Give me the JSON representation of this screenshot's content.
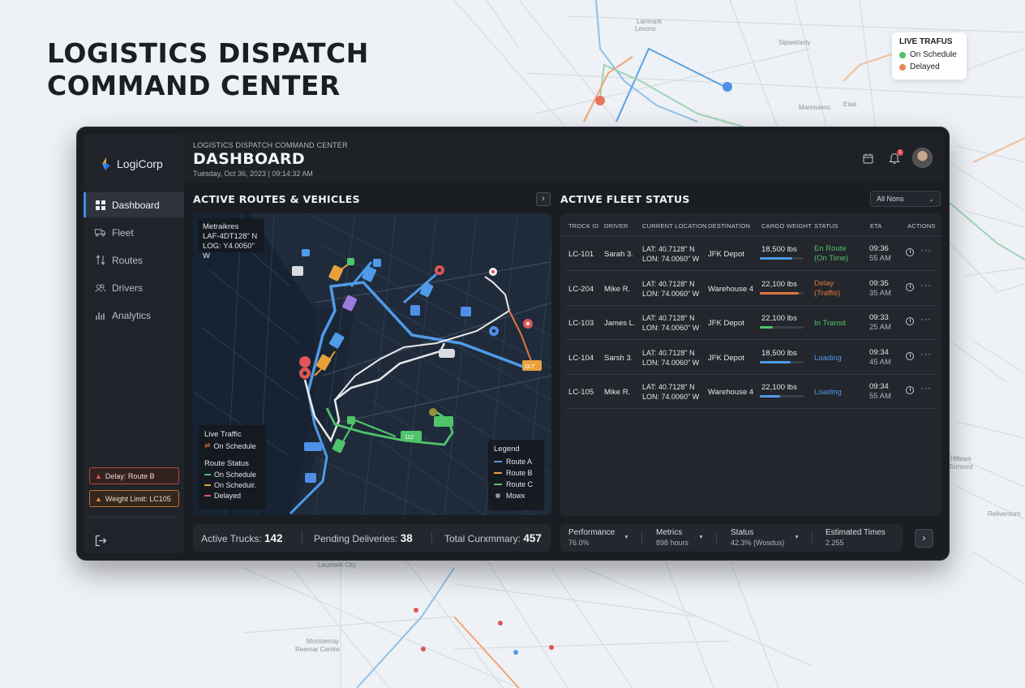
{
  "hero": {
    "line1": "LOGISTICS DISPATCH",
    "line2": "COMMAND CENTER"
  },
  "live_card": {
    "title": "LIVE TRAFUS",
    "items": [
      {
        "label": "On Schedule",
        "color": "#4fc46a"
      },
      {
        "label": "Delayed",
        "color": "#e58a5a"
      }
    ]
  },
  "background_labels": {
    "l1": "Lanmark",
    "l2": "Lexons",
    "l3": "Sipwetterty",
    "l4": "Maretoienc",
    "l5": "Etae",
    "l6": "Leumark City",
    "l7": "Montserray",
    "l8": "Reemar Centre",
    "l9": "Hitlows",
    "l10": "Tormord",
    "l11": "Reliveroum"
  },
  "logo": {
    "name": "LogiCorp"
  },
  "header": {
    "supertitle": "LOGISTICS DISPATCH COMMAND CENTER",
    "title": "DASHBOARD",
    "datetime": "Tuesday, Oct 36, 2023 | 09:14:32 AM",
    "notification_count": "1"
  },
  "nav": [
    {
      "label": "Dashboard",
      "icon": "grid-icon",
      "active": true
    },
    {
      "label": "Fleet",
      "icon": "truck-icon",
      "active": false
    },
    {
      "label": "Routes",
      "icon": "route-icon",
      "active": false
    },
    {
      "label": "Drivers",
      "icon": "users-icon",
      "active": false
    },
    {
      "label": "Analytics",
      "icon": "bar-chart-icon",
      "active": false
    }
  ],
  "alerts": [
    {
      "label": "Delay: Route B"
    },
    {
      "label": "Weight Limit: LC105"
    }
  ],
  "routes_section": {
    "title": "ACTIVE ROUTES & VEHICLES",
    "coords": {
      "line1": "Metraikres",
      "line2": "LAF-4DT128\" N",
      "line3": "LOG: Y4.0050\" W"
    },
    "traffic": {
      "title": "Live Traffic",
      "live_item": "On Schedule",
      "status_title": "Route Status",
      "items": [
        {
          "label": "On Schedule",
          "color": "#4fc46a"
        },
        {
          "label": "On Scheduir.",
          "color": "#e8a13a"
        },
        {
          "label": "Delayed",
          "color": "#e05555"
        }
      ]
    },
    "legend": {
      "title": "Legend",
      "items": [
        {
          "label": "Route A",
          "color": "#4f9be8"
        },
        {
          "label": "Route B",
          "color": "#e8a13a"
        },
        {
          "label": "Route C",
          "color": "#4fc46a"
        },
        {
          "label": "Mowx",
          "color": "#8e949d"
        }
      ]
    },
    "truck_labels": {
      "t1": "112",
      "t2": "DLT"
    }
  },
  "fleet": {
    "title": "ACTIVE FLEET STATUS",
    "filter": "All Nons",
    "columns": [
      "TROCK ID",
      "DRIVER",
      "CURRENT LOCATION",
      "DESTINATION",
      "CARGO WEIGHT",
      "STATUS",
      "ETA",
      "ACTIONS"
    ],
    "rows": [
      {
        "id": "LC-101",
        "driver": "Sarah 3.",
        "lat": "LAT: 40.7128\" N",
        "lon": "LON: 74.0060\" W",
        "dest": "JFK Depot",
        "cargo": "18,500 lbs",
        "cargo_pct": 0.74,
        "cargo_color": "#4f9be8",
        "status1": "En Route",
        "status2": "(On Time)",
        "status_color": "#4fc46a",
        "eta1": "09:36",
        "eta2": "55 AM"
      },
      {
        "id": "LC-204",
        "driver": "Mike R.",
        "lat": "LAT: 40.7128\" N",
        "lon": "LON: 74.0060\" W",
        "dest": "Warehouse 4",
        "cargo": "22,100 lbs",
        "cargo_pct": 0.88,
        "cargo_color": "#e0773f",
        "status1": "Delay",
        "status2": "(Traffis)",
        "status_color": "#e0773f",
        "eta1": "09:35",
        "eta2": "35 AM"
      },
      {
        "id": "LC-103",
        "driver": "James L.",
        "lat": "LAT: 40.7128\" N",
        "lon": "LON: 74.0060\" W",
        "dest": "JFK Depot",
        "cargo": "22,100 lbs",
        "cargo_pct": 0.3,
        "cargo_color": "#4fc46a",
        "status1": "In Transit",
        "status2": "",
        "status_color": "#4fc46a",
        "eta1": "09:33",
        "eta2": "25 AM"
      },
      {
        "id": "LC-104",
        "driver": "Sarsh 3.",
        "lat": "LAT: 40.7128\" N",
        "lon": "LON: 74.0060\" W",
        "dest": "JFK Depot",
        "cargo": "18,500 lbs",
        "cargo_pct": 0.7,
        "cargo_color": "#4f9be8",
        "status1": "Loading",
        "status2": "",
        "status_color": "#4f9be8",
        "eta1": "09:34",
        "eta2": "45 AM"
      },
      {
        "id": "LC-105",
        "driver": "Mike R.",
        "lat": "LAT: 40.7128\" N",
        "lon": "LON: 74.0060\" W",
        "dest": "Warehouse 4",
        "cargo": "22,100 lbs",
        "cargo_pct": 0.46,
        "cargo_color": "#4f9be8",
        "status1": "Loading",
        "status2": "",
        "status_color": "#4f9be8",
        "eta1": "09:34",
        "eta2": "55 AM"
      }
    ]
  },
  "stats": [
    {
      "label": "Active Trucks:",
      "value": "142"
    },
    {
      "label": "Pending Deliveries:",
      "value": "38"
    },
    {
      "label": "Total Curxmmary:",
      "value": "457"
    }
  ],
  "metrics": [
    {
      "label": "Performance",
      "value": "76.0%"
    },
    {
      "label": "Metrics",
      "value": "898 hours"
    },
    {
      "label": "Status",
      "value": "42.3% (Wosdus)"
    },
    {
      "label": "Estimated Times",
      "value": "2.255"
    }
  ]
}
